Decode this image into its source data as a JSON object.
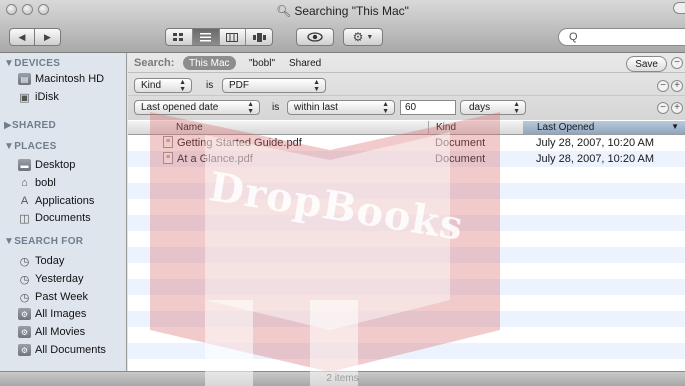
{
  "window": {
    "title": "Searching \"This Mac\""
  },
  "toolbar": {
    "back_label": "◀",
    "forward_label": "▶",
    "view_icons": "icon-view-icon",
    "view_list": "list-view-icon",
    "view_columns": "column-view-icon",
    "view_coverflow": "coverflow-view-icon",
    "quicklook_icon": "eye-icon",
    "action_icon": "gear-icon",
    "search_value": "Q"
  },
  "sidebar": {
    "devices_header": "▼DEVICES",
    "devices": [
      {
        "label": "Macintosh HD",
        "icon": "hard-drive-icon"
      },
      {
        "label": "iDisk",
        "icon": "idisk-icon"
      }
    ],
    "shared_header": "▶SHARED",
    "places_header": "▼PLACES",
    "places": [
      {
        "label": "Desktop",
        "icon": "desktop-icon"
      },
      {
        "label": "bobl",
        "icon": "home-icon"
      },
      {
        "label": "Applications",
        "icon": "applications-icon"
      },
      {
        "label": "Documents",
        "icon": "documents-icon"
      }
    ],
    "search_header": "▼SEARCH FOR",
    "searches": [
      {
        "label": "Today",
        "icon": "clock-icon"
      },
      {
        "label": "Yesterday",
        "icon": "clock-icon"
      },
      {
        "label": "Past Week",
        "icon": "clock-icon"
      },
      {
        "label": "All Images",
        "icon": "smart-folder-icon"
      },
      {
        "label": "All Movies",
        "icon": "smart-folder-icon"
      },
      {
        "label": "All Documents",
        "icon": "smart-folder-icon"
      }
    ]
  },
  "searchbar": {
    "label": "Search:",
    "scope_this_mac": "This Mac",
    "scope_bobl": "\"bobl\"",
    "scope_shared": "Shared",
    "save_label": "Save",
    "rule1": {
      "attribute": "Kind",
      "operator": "is",
      "value": "PDF"
    },
    "rule2": {
      "attribute": "Last opened date",
      "operator": "is",
      "condition": "within last",
      "number": "60",
      "unit": "days"
    }
  },
  "table": {
    "columns": [
      "Name",
      "Kind",
      "Last Opened"
    ],
    "sort_indicator": "▼",
    "rows": [
      {
        "name": "Getting Started Guide.pdf",
        "kind": "Document",
        "last_opened": "July 28, 2007, 10:20 AM"
      },
      {
        "name": "At a Glance.pdf",
        "kind": "Document",
        "last_opened": "July 28, 2007, 10:20 AM"
      }
    ]
  },
  "status": {
    "items_count": "2 items"
  },
  "watermark": {
    "text": "DropBooks"
  },
  "colors": {
    "sidebar_bg": "#dfe5ed",
    "row_alt": "#edf3fe",
    "sorted_header": "#9fb4ca",
    "watermark_book": "#d66a6a"
  }
}
